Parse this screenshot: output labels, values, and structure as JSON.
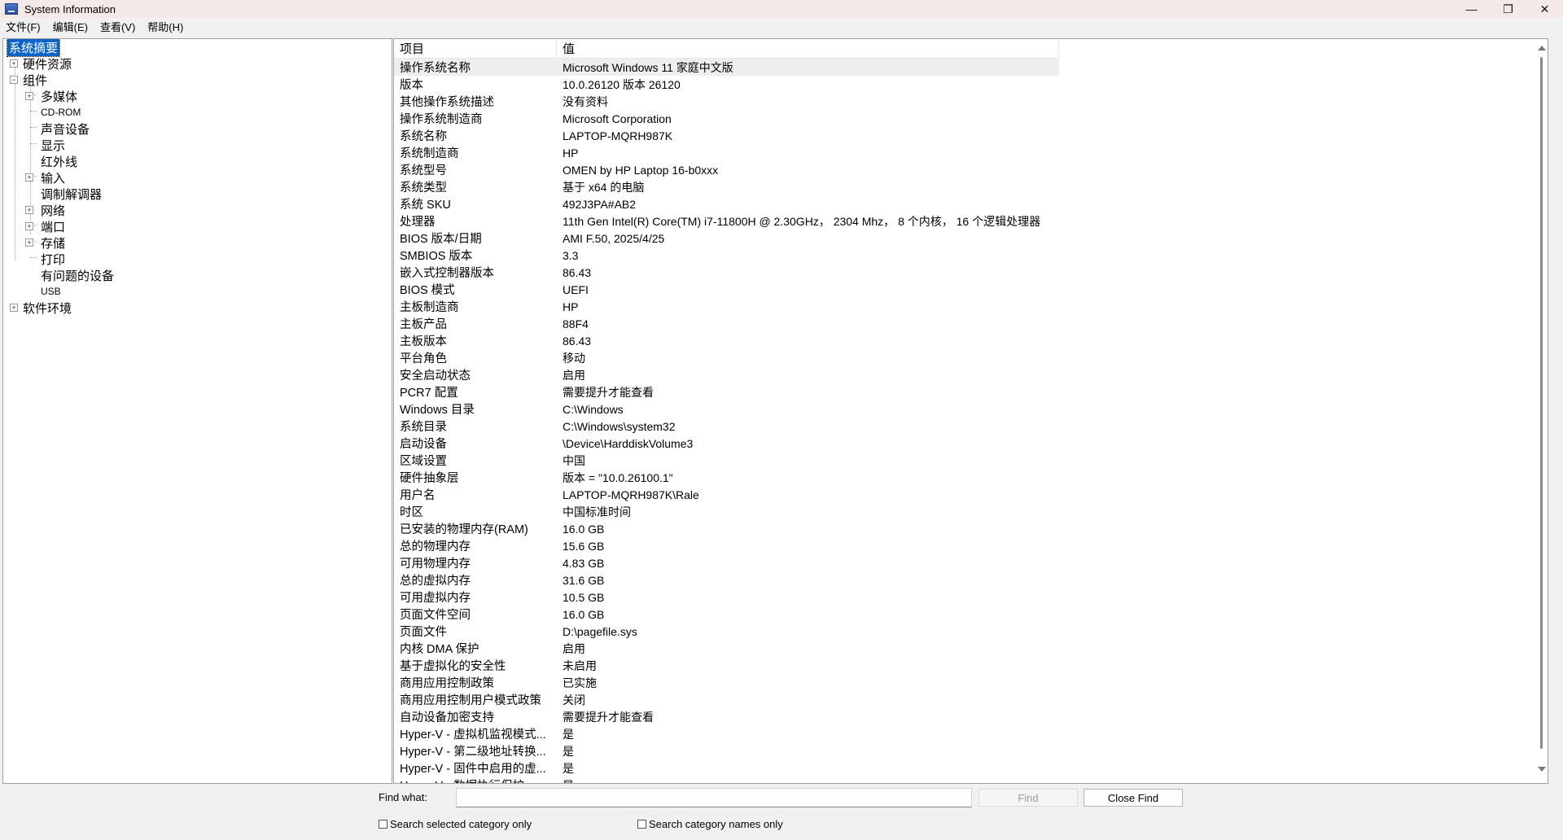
{
  "window": {
    "title": "System Information",
    "controls": {
      "minimize": "—",
      "restore": "❐",
      "close": "✕"
    }
  },
  "menu": [
    "文件(F)",
    "编辑(E)",
    "查看(V)",
    "帮助(H)"
  ],
  "tree": {
    "root_selected": "系统摘要",
    "hardware": "硬件资源",
    "components": "组件",
    "multimedia": "多媒体",
    "cdrom": "CD-ROM",
    "sound": "声音设备",
    "display": "显示",
    "infrared": "红外线",
    "input": "输入",
    "modem": "调制解调器",
    "network": "网络",
    "ports": "端口",
    "storage": "存储",
    "print": "打印",
    "problem_devices": "有问题的设备",
    "usb": "USB",
    "software": "软件环境"
  },
  "details": {
    "col_item": "项目",
    "col_value": "值",
    "rows": [
      {
        "item": "操作系统名称",
        "value": "Microsoft Windows 11 家庭中文版"
      },
      {
        "item": "版本",
        "value": "10.0.26120 版本 26120"
      },
      {
        "item": "其他操作系统描述",
        "value": "没有资料"
      },
      {
        "item": "操作系统制造商",
        "value": "Microsoft Corporation"
      },
      {
        "item": "系统名称",
        "value": "LAPTOP-MQRH987K"
      },
      {
        "item": "系统制造商",
        "value": "HP"
      },
      {
        "item": "系统型号",
        "value": "OMEN by HP Laptop 16-b0xxx"
      },
      {
        "item": "系统类型",
        "value": "基于 x64 的电脑"
      },
      {
        "item": "系统 SKU",
        "value": "492J3PA#AB2"
      },
      {
        "item": "处理器",
        "value": "11th Gen Intel(R) Core(TM) i7-11800H @ 2.30GHz， 2304 Mhz， 8 个内核， 16 个逻辑处理器"
      },
      {
        "item": "BIOS 版本/日期",
        "value": "AMI F.50, 2025/4/25"
      },
      {
        "item": "SMBIOS 版本",
        "value": "3.3"
      },
      {
        "item": "嵌入式控制器版本",
        "value": "86.43"
      },
      {
        "item": "BIOS 模式",
        "value": "UEFI"
      },
      {
        "item": "主板制造商",
        "value": "HP"
      },
      {
        "item": "主板产品",
        "value": "88F4"
      },
      {
        "item": "主板版本",
        "value": "86.43"
      },
      {
        "item": "平台角色",
        "value": "移动"
      },
      {
        "item": "安全启动状态",
        "value": "启用"
      },
      {
        "item": "PCR7 配置",
        "value": "需要提升才能查看"
      },
      {
        "item": "Windows 目录",
        "value": "C:\\Windows"
      },
      {
        "item": "系统目录",
        "value": "C:\\Windows\\system32"
      },
      {
        "item": "启动设备",
        "value": "\\Device\\HarddiskVolume3"
      },
      {
        "item": "区域设置",
        "value": "中国"
      },
      {
        "item": "硬件抽象层",
        "value": "版本 = \"10.0.26100.1\""
      },
      {
        "item": "用户名",
        "value": "LAPTOP-MQRH987K\\Rale"
      },
      {
        "item": "时区",
        "value": "中国标准时间"
      },
      {
        "item": "已安装的物理内存(RAM)",
        "value": "16.0 GB"
      },
      {
        "item": "总的物理内存",
        "value": "15.6 GB"
      },
      {
        "item": "可用物理内存",
        "value": "4.83 GB"
      },
      {
        "item": "总的虚拟内存",
        "value": "31.6 GB"
      },
      {
        "item": "可用虚拟内存",
        "value": "10.5 GB"
      },
      {
        "item": "页面文件空间",
        "value": "16.0 GB"
      },
      {
        "item": "页面文件",
        "value": "D:\\pagefile.sys"
      },
      {
        "item": "内核 DMA 保护",
        "value": "启用"
      },
      {
        "item": "基于虚拟化的安全性",
        "value": "未启用"
      },
      {
        "item": "商用应用控制政策",
        "value": "已实施"
      },
      {
        "item": "商用应用控制用户模式政策",
        "value": "关闭"
      },
      {
        "item": "自动设备加密支持",
        "value": "需要提升才能查看"
      },
      {
        "item": "Hyper-V - 虚拟机监视模式...",
        "value": "是"
      },
      {
        "item": "Hyper-V - 第二级地址转换...",
        "value": "是"
      },
      {
        "item": "Hyper-V - 固件中启用的虚...",
        "value": "是"
      },
      {
        "item": "Hyper-V - 数据执行保护",
        "value": "是"
      }
    ]
  },
  "find": {
    "label": "Find what:",
    "value": "",
    "find_button": "Find",
    "close_button": "Close Find",
    "check_selected": "Search selected category only",
    "check_names": "Search category names only"
  }
}
